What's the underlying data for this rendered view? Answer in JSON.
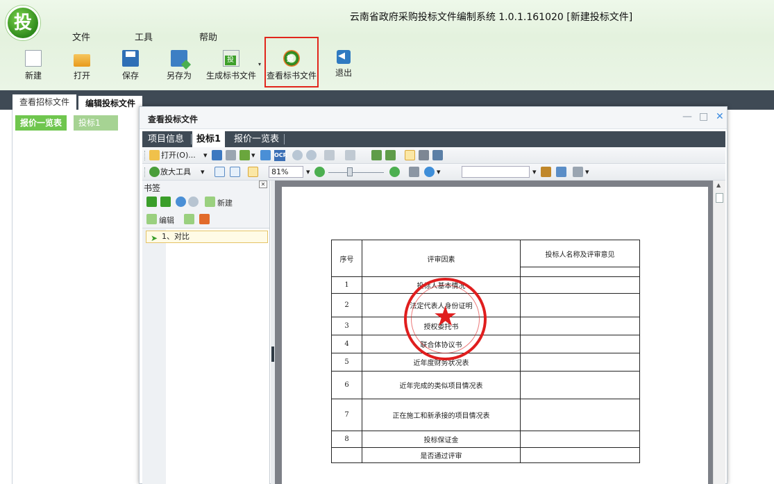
{
  "window": {
    "title": "云南省政府采购投标文件编制系统 1.0.1.161020 [新建投标文件]",
    "logo_text": "投"
  },
  "menu": [
    "文件",
    "工具",
    "帮助"
  ],
  "toolbar": {
    "new": "新建",
    "open": "打开",
    "save": "保存",
    "save_as": "另存为",
    "generate_bid": "生成标书文件",
    "view_bid": "查看标书文件",
    "exit": "退出"
  },
  "main_tabs": [
    "查看招标文件",
    "编辑投标文件"
  ],
  "sub_tabs": [
    "报价一览表",
    "投标1"
  ],
  "dialog": {
    "title": "查看投标文件",
    "controls": {
      "minimize": "—",
      "maximize": "□",
      "close": "✕"
    },
    "tabs": [
      "项目信息",
      "投标1",
      "报价一览表"
    ],
    "viewer": {
      "open_label": "打开(O)...",
      "zoom_tool_label": "放大工具",
      "zoom_value": "81%",
      "ocr_label": "OCR"
    },
    "bookmarks": {
      "title": "书签",
      "new_label": "新建",
      "edit_label": "编辑",
      "items": [
        "1、对比"
      ]
    },
    "document": {
      "header": {
        "no": "序号",
        "factor": "评审因素",
        "opinion": "投标人名称及评审意见"
      },
      "rows": [
        {
          "no": "1",
          "factor": "投标人基本情况"
        },
        {
          "no": "2",
          "factor": "法定代表人身份证明"
        },
        {
          "no": "3",
          "factor": "授权委托书"
        },
        {
          "no": "4",
          "factor": "联合体协议书"
        },
        {
          "no": "5",
          "factor": "近年度财务状况表"
        },
        {
          "no": "6",
          "factor": "近年完成的类似项目情况表"
        },
        {
          "no": "7",
          "factor": "正在施工和新承接的项目情况表"
        },
        {
          "no": "8",
          "factor": "投标保证金"
        },
        {
          "no": "",
          "factor": "是否通过评审"
        }
      ]
    }
  },
  "colors": {
    "accent_green": "#6fc64e",
    "dark_bar": "#3f4a55",
    "highlight_red": "#e1251b",
    "seal_red": "#e01e1e"
  }
}
